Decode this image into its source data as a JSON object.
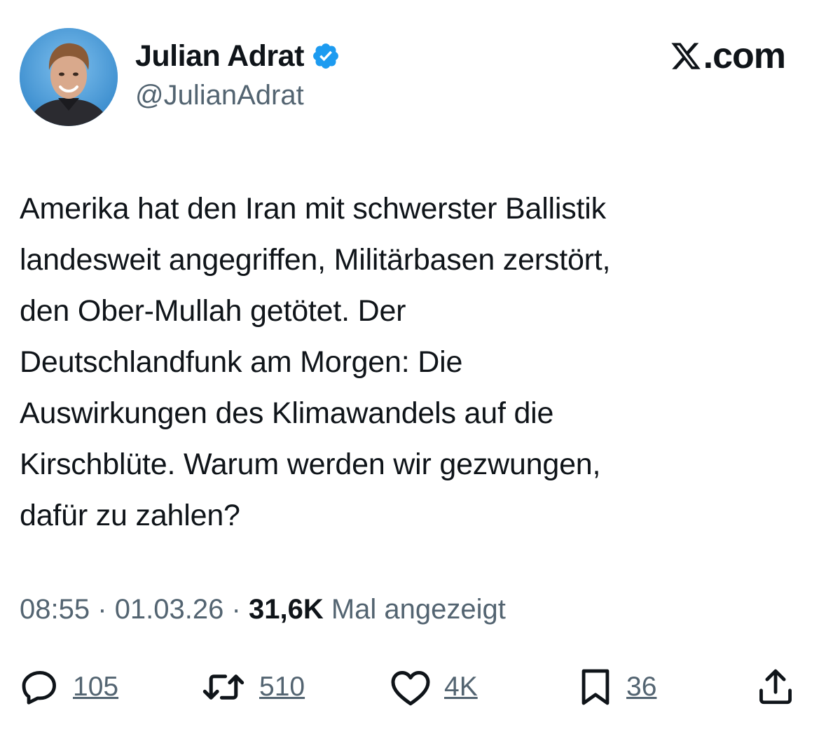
{
  "author": {
    "name": "Julian Adrat",
    "handle": "@JulianAdrat",
    "verified": true,
    "verified_color": "#1d9bf0",
    "avatar_icon": "avatar-photo"
  },
  "brand": {
    "icon": "x-logo-icon",
    "text": ".com"
  },
  "tweet": {
    "text": "Amerika hat den Iran mit schwerster Ballistik\nlandesweit angegriffen, Militärbasen zerstört,\nden Ober-Mullah getötet. Der\nDeutschlandfunk am Morgen: Die\nAuswirkungen des Klimawandels auf die\nKirschblüte. Warum werden wir gezwungen,\ndafür zu zahlen?"
  },
  "meta": {
    "time": "08:55",
    "separator": "·",
    "date": "01.03.26",
    "views_count": "31,6K",
    "views_label": "Mal angezeigt"
  },
  "actions": {
    "reply": {
      "icon": "reply-icon",
      "count": "105"
    },
    "retweet": {
      "icon": "retweet-icon",
      "count": "510"
    },
    "like": {
      "icon": "heart-icon",
      "count": "4K"
    },
    "bookmark": {
      "icon": "bookmark-icon",
      "count": "36"
    },
    "share": {
      "icon": "share-icon"
    }
  },
  "colors": {
    "text": "#0f1419",
    "secondary": "#536471",
    "verified": "#1d9bf0"
  }
}
